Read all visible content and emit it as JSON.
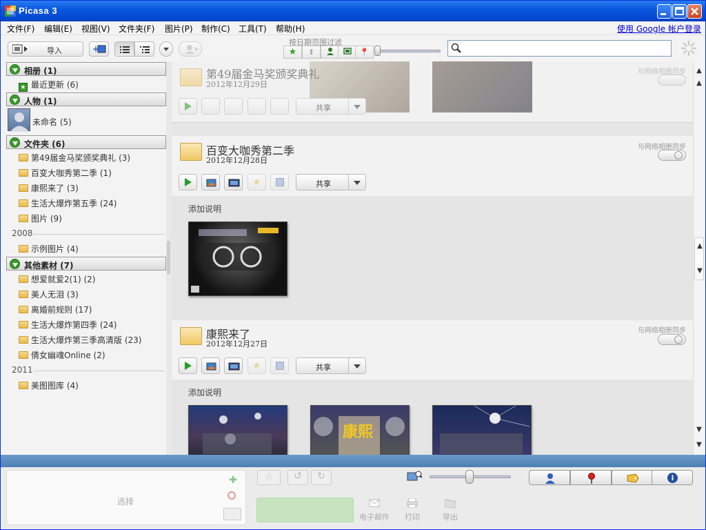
{
  "window": {
    "title": "Picasa 3",
    "signin": "使用 Google 帐户登录"
  },
  "menu": [
    "文件(F)",
    "编辑(E)",
    "视图(V)",
    "文件夹(F)",
    "图片(P)",
    "制作(C)",
    "工具(T)",
    "帮助(H)"
  ],
  "toolbar": {
    "import_label": "导入",
    "filter_label": "按日期范围过滤",
    "search_placeholder": ""
  },
  "sidebar": {
    "albums": {
      "label": "相册 (1)",
      "items": [
        {
          "label": "最近更新 (6)"
        }
      ]
    },
    "people": {
      "label": "人物 (1)",
      "items": [
        {
          "label": "未命名 (5)"
        }
      ]
    },
    "folders": {
      "label": "文件夹 (6)",
      "items": [
        {
          "label": "第49届金马奖颁奖典礼 (3)"
        },
        {
          "label": "百变大咖秀第二季 (1)"
        },
        {
          "label": "康熙来了 (3)"
        },
        {
          "label": "生活大爆炸第五季 (24)"
        },
        {
          "label": "图片 (9)"
        }
      ]
    },
    "year_2008": "2008",
    "items_2008": [
      {
        "label": "示例图片 (4)"
      }
    ],
    "other": {
      "label": "其他素材 (7)",
      "items": [
        {
          "label": "想爱就爱2(1) (2)"
        },
        {
          "label": "美人无泪 (3)"
        },
        {
          "label": "离婚前规则 (17)"
        },
        {
          "label": "生活大爆炸第四季 (24)"
        },
        {
          "label": "生活大爆炸第三季高清版 (23)"
        },
        {
          "label": "倩女幽魂Online (2)"
        }
      ]
    },
    "year_2011": "2011",
    "items_2011": [
      {
        "label": "美图图库 (4)"
      }
    ]
  },
  "albums": [
    {
      "title": "第49届金马奖颁奖典礼",
      "date": "2012年12月29日",
      "sync": "与网络相册同步",
      "share": "共享"
    },
    {
      "title": "百变大咖秀第二季",
      "date": "2012年12月28日",
      "sync": "与网络相册同步",
      "share": "共享",
      "caption": "添加说明"
    },
    {
      "title": "康熙来了",
      "date": "2012年12月27日",
      "sync": "与网络相册同步",
      "share": "共享",
      "caption": "添加说明"
    }
  ],
  "bottom": {
    "tray_label": "选择",
    "email": "电子邮件",
    "print": "打印",
    "export": "导出"
  },
  "colors": {
    "titlebar": "#0a58e0",
    "bluebar": "#5a8cbf",
    "accent_green": "#3a9b2a"
  }
}
